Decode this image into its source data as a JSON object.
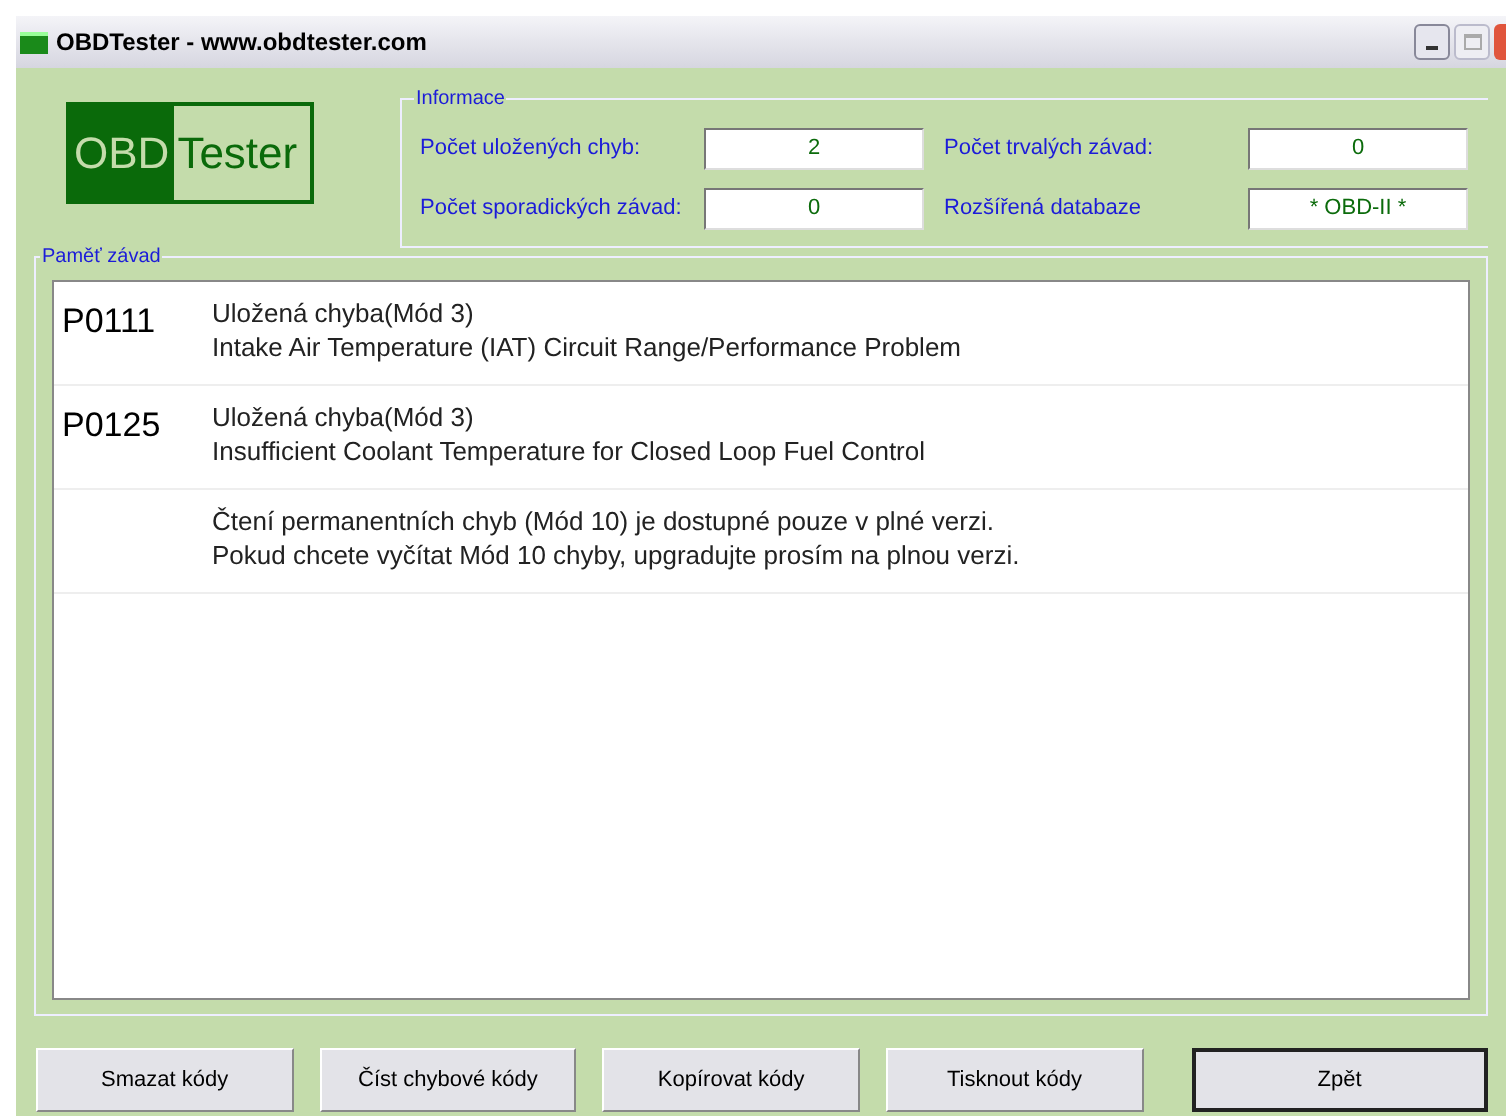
{
  "window": {
    "title": "OBDTester - www.obdtester.com"
  },
  "logo": {
    "part_1": "OBD",
    "part_2": "Tester"
  },
  "info": {
    "title": "Informace",
    "fields": [
      {
        "label": "Počet uložených chyb:",
        "value": "2"
      },
      {
        "label": "Počet trvalých závad:",
        "value": "0"
      },
      {
        "label": "Počet sporadických závad:",
        "value": "0"
      },
      {
        "label": "Rozšířená databaze",
        "value": "* OBD-II *"
      }
    ]
  },
  "memory": {
    "title": "Paměť závad",
    "rows": [
      {
        "code": "P0111",
        "line_1": "Uložená chyba(Mód 3)",
        "line_2": "Intake Air Temperature (IAT) Circuit Range/Performance Problem"
      },
      {
        "code": "P0125",
        "line_1": "Uložená chyba(Mód 3)",
        "line_2": "Insufficient Coolant Temperature for Closed Loop Fuel Control"
      },
      {
        "line_1": "Čtení permanentních chyb (Mód 10) je dostupné pouze v plné verzi.",
        "line_2": "Pokud chcete vyčítat Mód 10 chyby, upgradujte prosím na plnou verzi."
      }
    ]
  },
  "buttons": [
    {
      "label": "Smazat kódy",
      "default": false
    },
    {
      "label": "Číst chybové kódy",
      "default": false
    },
    {
      "label": "Kopírovat kódy",
      "default": false
    },
    {
      "label": "Tisknout kódy",
      "default": false
    },
    {
      "label": "Zpět",
      "default": true
    }
  ]
}
